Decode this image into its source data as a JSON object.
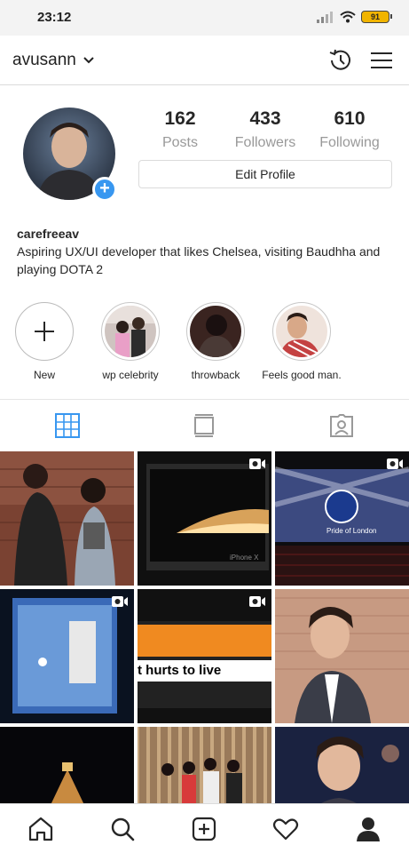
{
  "status": {
    "time": "23:12",
    "battery": "91"
  },
  "header": {
    "username": "avusann"
  },
  "profile": {
    "stats": [
      {
        "value": "162",
        "label": "Posts"
      },
      {
        "value": "433",
        "label": "Followers"
      },
      {
        "value": "610",
        "label": "Following"
      }
    ],
    "edit_label": "Edit Profile",
    "bio_name": "carefreeav",
    "bio_text": "Aspiring UX/UI developer that likes Chelsea, visiting Baudhha and playing DOTA 2"
  },
  "highlights": [
    {
      "label": "New"
    },
    {
      "label": "wp celebrity"
    },
    {
      "label": "throwback"
    },
    {
      "label": "Feels good man."
    }
  ],
  "tabs": [
    {
      "icon": "grid-icon",
      "active": true
    },
    {
      "icon": "feed-icon",
      "active": false
    },
    {
      "icon": "tagged-icon",
      "active": false
    }
  ],
  "grid_overlays": {
    "photo_4": "t hurts to live"
  },
  "colors": {
    "accent": "#3897f0",
    "divider": "#dbdbdb",
    "battery": "#f1b400"
  },
  "nav": [
    "home-icon",
    "search-icon",
    "add-post-icon",
    "heart-icon",
    "profile-icon"
  ]
}
